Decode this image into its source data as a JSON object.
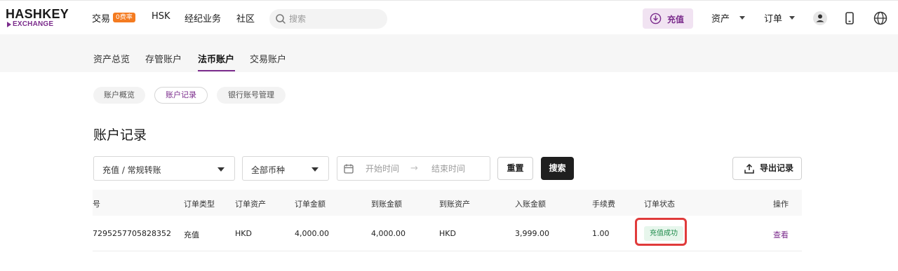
{
  "brand": {
    "logo_main": "HASHKEY",
    "logo_sub": "EXCHANGE",
    "accent": "#7b2c8c"
  },
  "topnav": {
    "trade": "交易",
    "fee_badge": "0费率",
    "hsk": "HSK",
    "brokerage": "经纪业务",
    "community": "社区",
    "search_placeholder": "搜索",
    "deposit": "充值",
    "assets": "资产",
    "orders": "订单",
    "icons": [
      "search-icon",
      "download-icon",
      "user-icon",
      "phone-icon",
      "globe-icon"
    ]
  },
  "subtabs": [
    "资产总览",
    "存管账户",
    "法币账户",
    "交易账户"
  ],
  "active_subtab": "法币账户",
  "pills": [
    "账户概览",
    "账户记录",
    "银行账号管理"
  ],
  "active_pill": "账户记录",
  "page_title": "账户记录",
  "filters": {
    "type_select": "充值 / 常规转账",
    "currency_select": "全部币种",
    "start_placeholder": "开始时间",
    "end_placeholder": "结束时间",
    "reset": "重置",
    "search": "搜索",
    "export": "导出记录"
  },
  "table": {
    "columns": [
      "号",
      "订单类型",
      "订单资产",
      "订单金额",
      "到账金额",
      "到账资产",
      "入账金额",
      "手续费",
      "订单状态",
      "操作"
    ],
    "rows": [
      {
        "order_no": "7295257705828352",
        "type": "充值",
        "asset": "HKD",
        "amount": "4,000.00",
        "received": "4,000.00",
        "received_asset": "HKD",
        "credited": "3,999.00",
        "fee": "1.00",
        "status": "充值成功",
        "action": "查看"
      }
    ]
  },
  "colors": {
    "status_success_bg": "#e7f6ec",
    "status_success_text": "#1d8a4a",
    "highlight": "#e03b3b"
  }
}
